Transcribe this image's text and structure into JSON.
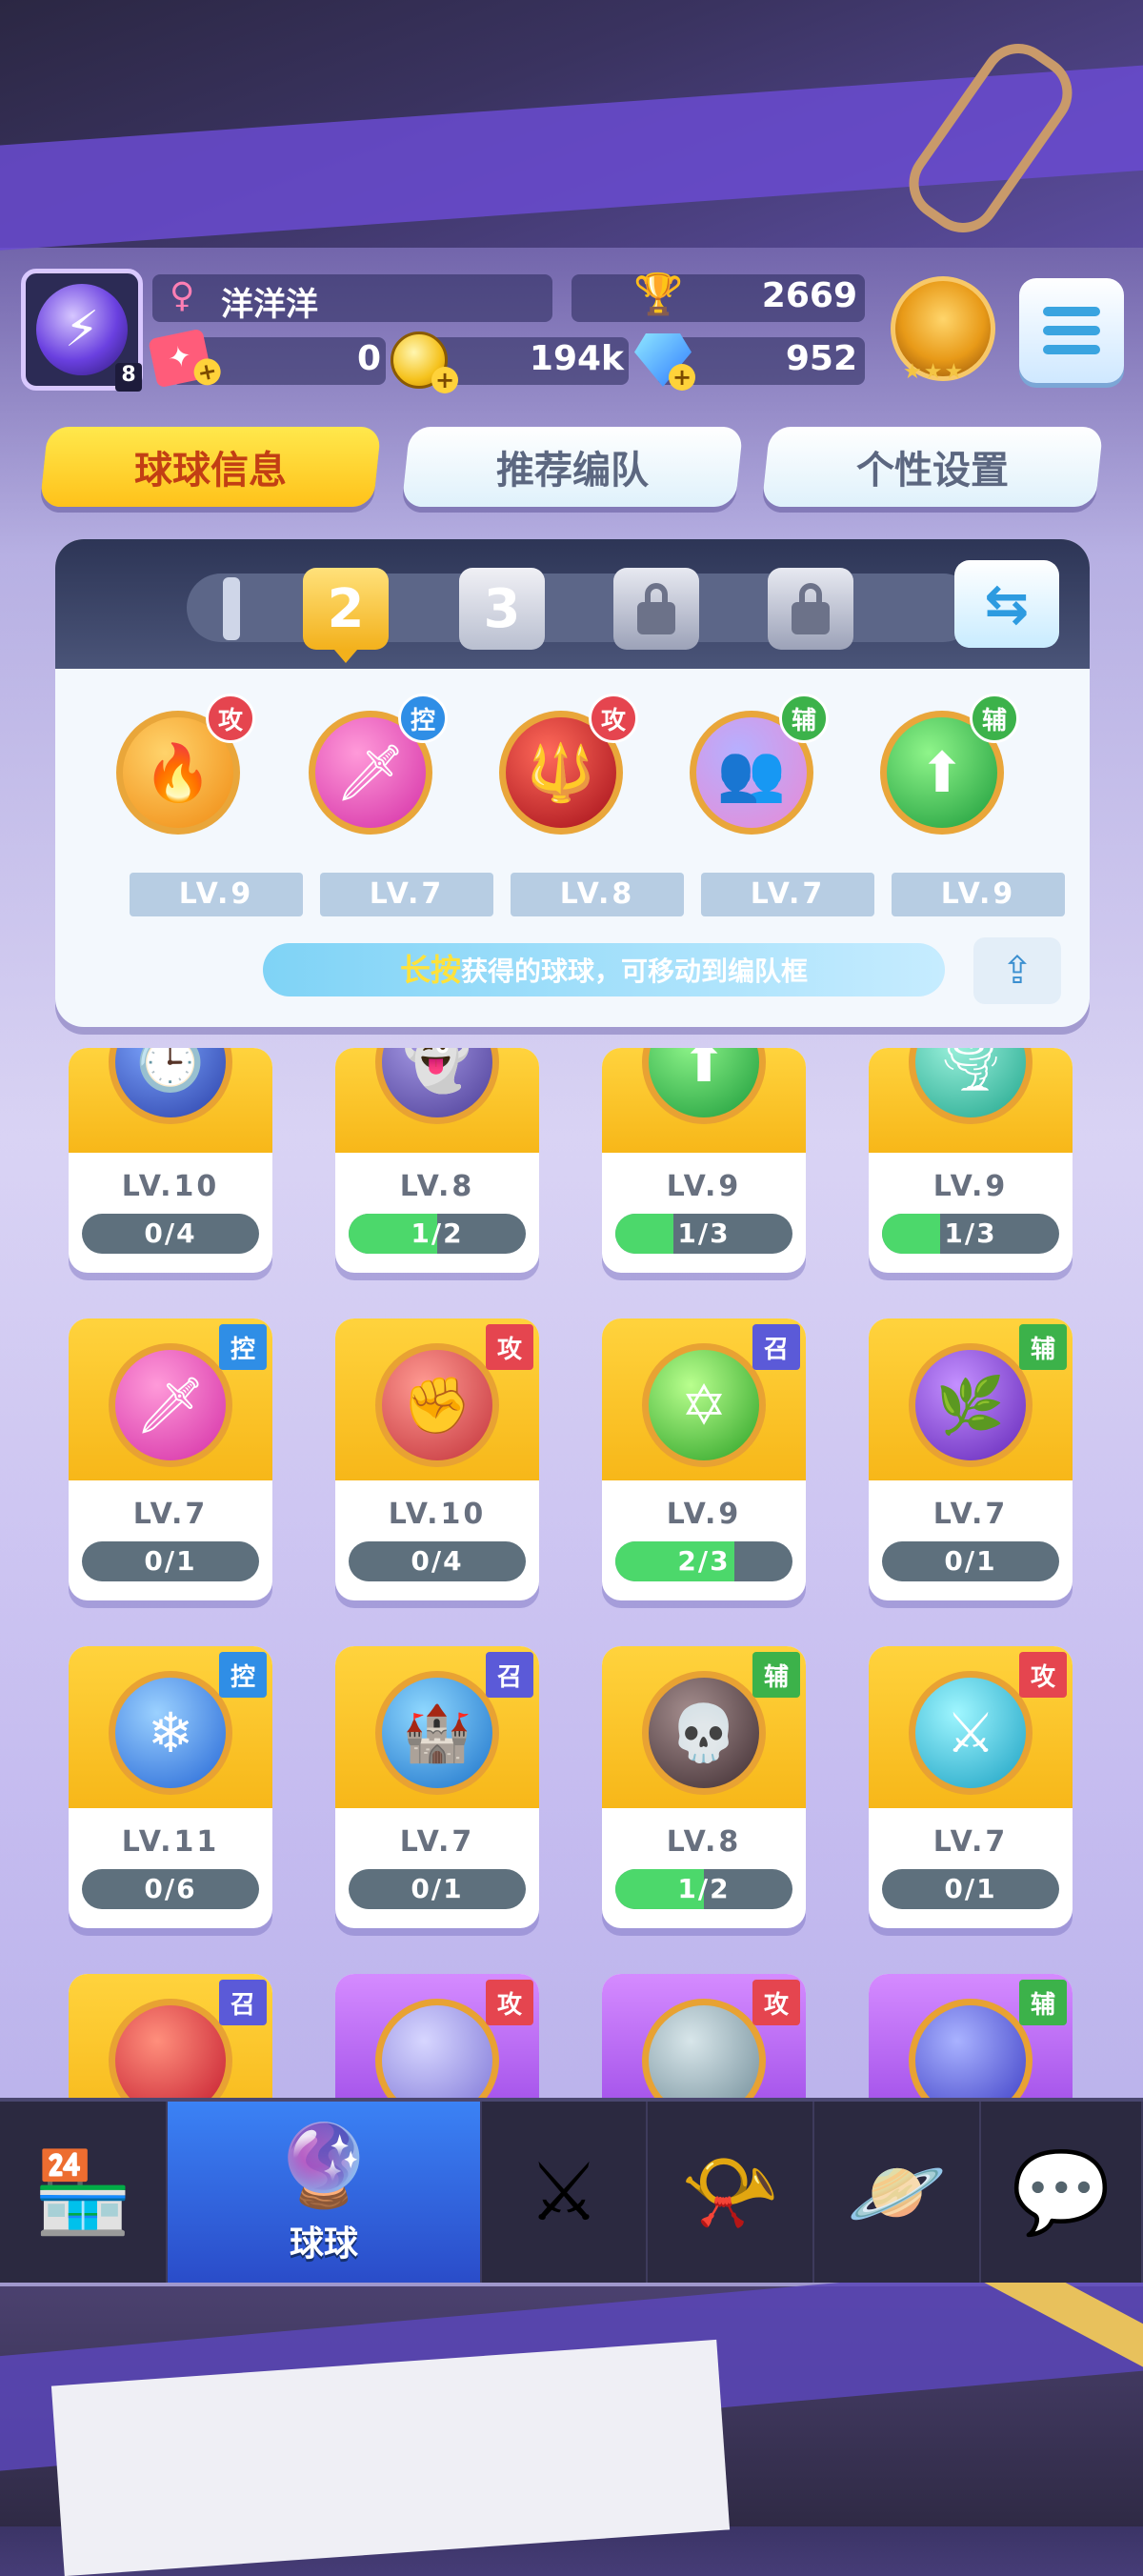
{
  "player": {
    "name": "洋洋洋",
    "avatar_level": "8",
    "gender_icon": "♀",
    "trophies": "2669",
    "tickets": "0",
    "coins": "194k",
    "gems": "952",
    "rank_stars": "★★★"
  },
  "tabs": [
    {
      "label": "球球信息"
    },
    {
      "label": "推荐编队"
    },
    {
      "label": "个性设置"
    }
  ],
  "team_slots": [
    {
      "label": "2"
    },
    {
      "label": "3"
    }
  ],
  "team": [
    {
      "level": "LV.9",
      "role": "攻",
      "role_color": "#e5454f",
      "colors": [
        "#ffd36b",
        "#f08a12"
      ],
      "glyph": "🔥"
    },
    {
      "level": "LV.7",
      "role": "控",
      "role_color": "#2f8ee6",
      "colors": [
        "#ff9ad9",
        "#d42ea6"
      ],
      "glyph": "🗡"
    },
    {
      "level": "LV.8",
      "role": "攻",
      "role_color": "#e5454f",
      "colors": [
        "#ff6a5a",
        "#a30e19"
      ],
      "glyph": "🔱"
    },
    {
      "level": "LV.7",
      "role": "辅",
      "role_color": "#3cb24a",
      "colors": [
        "#b6b0ff",
        "#e88ad6"
      ],
      "glyph": "👥"
    },
    {
      "level": "LV.9",
      "role": "辅",
      "role_color": "#3cb24a",
      "colors": [
        "#8ff58a",
        "#1b9a3a"
      ],
      "glyph": "⬆"
    }
  ],
  "hint": {
    "highlight": "长按",
    "text": "获得的球球，可移动到编队框"
  },
  "cards": [
    {
      "level": "LV.10",
      "progress": "0/4",
      "ratio": 0.0,
      "role": "",
      "role_color": "",
      "top": "yellow",
      "colors": [
        "#7fa8ff",
        "#2a3fa8"
      ],
      "glyph": "🕒"
    },
    {
      "level": "LV.8",
      "progress": "1/2",
      "ratio": 0.5,
      "role": "",
      "role_color": "",
      "top": "yellow",
      "colors": [
        "#a79be6",
        "#4b3c96"
      ],
      "glyph": "👻"
    },
    {
      "level": "LV.9",
      "progress": "1/3",
      "ratio": 0.33,
      "role": "",
      "role_color": "",
      "top": "yellow",
      "colors": [
        "#8ff58a",
        "#1b9a3a"
      ],
      "glyph": "⬆"
    },
    {
      "level": "LV.9",
      "progress": "1/3",
      "ratio": 0.33,
      "role": "",
      "role_color": "",
      "top": "yellow",
      "colors": [
        "#9ff3de",
        "#1fa58c"
      ],
      "glyph": "🌪"
    },
    {
      "level": "LV.7",
      "progress": "0/1",
      "ratio": 0.0,
      "role": "控",
      "role_color": "#2f8ee6",
      "top": "yellow",
      "colors": [
        "#ff9ad9",
        "#d42ea6"
      ],
      "glyph": "🗡"
    },
    {
      "level": "LV.10",
      "progress": "0/4",
      "ratio": 0.0,
      "role": "攻",
      "role_color": "#e5454f",
      "top": "yellow",
      "colors": [
        "#ff9a92",
        "#c23139"
      ],
      "glyph": "✊"
    },
    {
      "level": "LV.9",
      "progress": "2/3",
      "ratio": 0.67,
      "role": "召",
      "role_color": "#5b5ad8",
      "top": "yellow",
      "colors": [
        "#b9ff8e",
        "#2aa024"
      ],
      "glyph": "✡"
    },
    {
      "level": "LV.7",
      "progress": "0/1",
      "ratio": 0.0,
      "role": "辅",
      "role_color": "#3cb24a",
      "top": "yellow",
      "colors": [
        "#c490ff",
        "#6326b8"
      ],
      "glyph": "🌿"
    },
    {
      "level": "LV.11",
      "progress": "0/6",
      "ratio": 0.0,
      "role": "控",
      "role_color": "#2f8ee6",
      "top": "yellow",
      "colors": [
        "#9bd1ff",
        "#2466d6"
      ],
      "glyph": "❄"
    },
    {
      "level": "LV.7",
      "progress": "0/1",
      "ratio": 0.0,
      "role": "召",
      "role_color": "#5b5ad8",
      "top": "yellow",
      "colors": [
        "#8fd8ff",
        "#1c72c9"
      ],
      "glyph": "🏰"
    },
    {
      "level": "LV.8",
      "progress": "1/2",
      "ratio": 0.5,
      "role": "辅",
      "role_color": "#3cb24a",
      "top": "yellow",
      "colors": [
        "#a58e8e",
        "#3d2b30"
      ],
      "glyph": "💀"
    },
    {
      "level": "LV.7",
      "progress": "0/1",
      "ratio": 0.0,
      "role": "攻",
      "role_color": "#e5454f",
      "top": "yellow",
      "colors": [
        "#9ff6ff",
        "#1aa0c2"
      ],
      "glyph": "⚔"
    },
    {
      "level": "",
      "progress": "",
      "ratio": 0.0,
      "role": "召",
      "role_color": "#5b5ad8",
      "top": "yellow",
      "colors": [
        "#ff8f7c",
        "#c3182c"
      ],
      "glyph": ""
    },
    {
      "level": "",
      "progress": "",
      "ratio": 0.0,
      "role": "攻",
      "role_color": "#e5454f",
      "top": "purple",
      "colors": [
        "#d7d6ff",
        "#7c74d6"
      ],
      "glyph": ""
    },
    {
      "level": "",
      "progress": "",
      "ratio": 0.0,
      "role": "攻",
      "role_color": "#e5454f",
      "top": "purple",
      "colors": [
        "#d8e6ea",
        "#6f8b97"
      ],
      "glyph": ""
    },
    {
      "level": "",
      "progress": "",
      "ratio": 0.0,
      "role": "辅",
      "role_color": "#3cb24a",
      "top": "purple",
      "colors": [
        "#a9b2ff",
        "#3a3bc4"
      ],
      "glyph": ""
    }
  ],
  "nav": [
    {
      "label": "",
      "icon": "shop-icon",
      "glyph": "🏪",
      "active": false
    },
    {
      "label": "球球",
      "icon": "balls-icon",
      "glyph": "🔮",
      "active": true
    },
    {
      "label": "",
      "icon": "battle-icon",
      "glyph": "⚔",
      "active": false
    },
    {
      "label": "",
      "icon": "whistle-icon",
      "glyph": "📯",
      "active": false
    },
    {
      "label": "",
      "icon": "planet-icon",
      "glyph": "🪐",
      "active": false
    },
    {
      "label": "",
      "icon": "chat-icon",
      "glyph": "💬",
      "active": false
    }
  ]
}
